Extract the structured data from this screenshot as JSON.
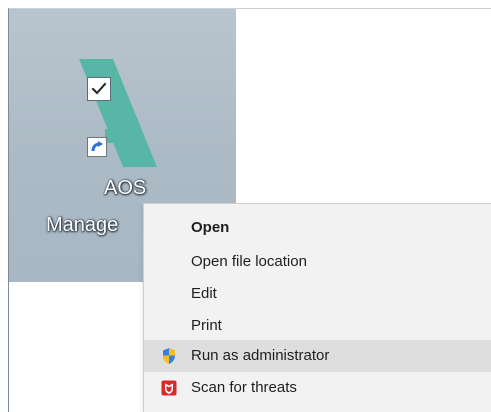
{
  "desktop_icon": {
    "label_line_1": "AOS",
    "label_line_2": "Manage",
    "logo_icon": "teal-a-logo",
    "overlay_icon": "checkbox-icon",
    "shortcut_icon": "shortcut-arrow-icon"
  },
  "context_menu": {
    "items": [
      {
        "label": "Open",
        "bold": true,
        "icon": "",
        "highlighted": false
      },
      {
        "label": "Open file location",
        "bold": false,
        "icon": "",
        "highlighted": false
      },
      {
        "label": "Edit",
        "bold": false,
        "icon": "",
        "highlighted": false
      },
      {
        "label": "Print",
        "bold": false,
        "icon": "",
        "highlighted": false
      },
      {
        "label": "Run as administrator",
        "bold": false,
        "icon": "uac-shield-icon",
        "highlighted": true
      },
      {
        "label": "Scan for threats",
        "bold": false,
        "icon": "mcafee-shield-icon",
        "highlighted": false
      }
    ]
  },
  "colors": {
    "selection_background": "#acbac5",
    "logo_teal": "#58b6a6",
    "menu_background": "#f2f2f2",
    "menu_highlight": "#dedede",
    "mcafee_red": "#d52b2b",
    "uac_blue": "#3a7ee4",
    "uac_yellow": "#f3c21c"
  }
}
